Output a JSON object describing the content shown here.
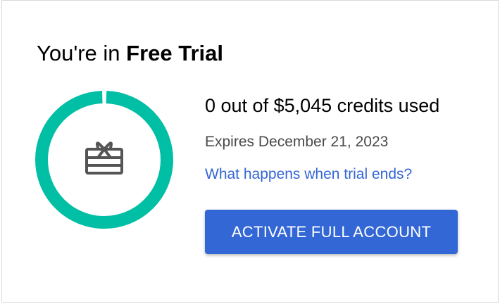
{
  "trial": {
    "title_prefix": "You're in ",
    "title_bold": "Free Trial",
    "credits_text": "0 out of $5,045 credits used",
    "credits_used": 0,
    "credits_total": 5045,
    "expires_text": "Expires December 21, 2023",
    "link_text": "What happens when trial ends?",
    "activate_label": "ACTIVATE FULL ACCOUNT"
  },
  "icons": {
    "ring": "credits-remaining-ring",
    "center": "gift-card-icon"
  },
  "colors": {
    "ring": "#00bfa5",
    "icon": "#555555",
    "link": "#3365d4",
    "button": "#3367d6",
    "button_text": "#ffffff"
  }
}
